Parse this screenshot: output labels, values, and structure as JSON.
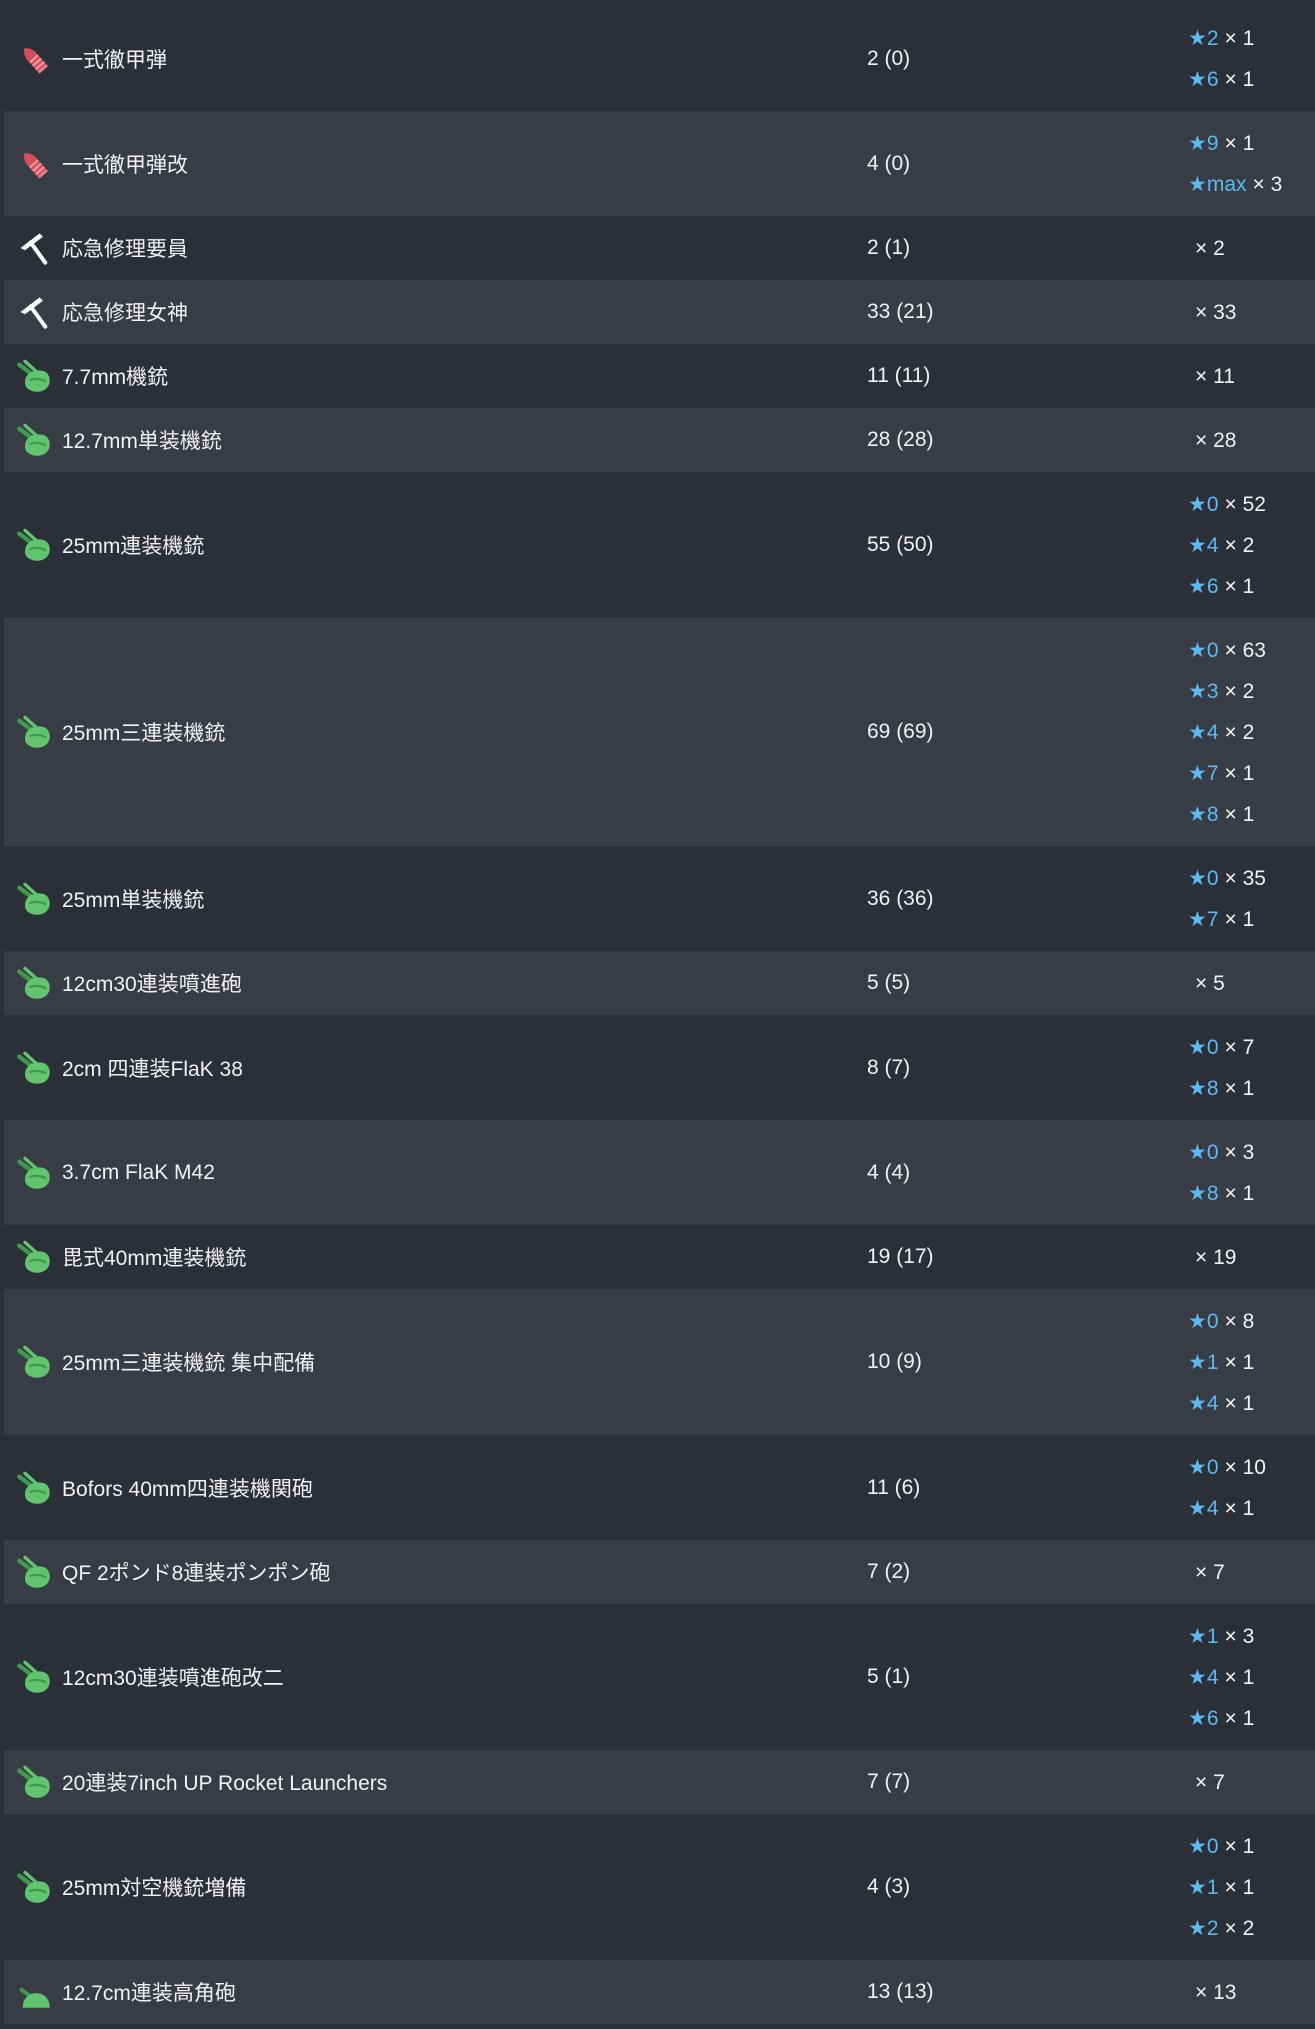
{
  "colors": {
    "background": "#2b2f37",
    "row_alt": "#383c45",
    "text": "#f2f2f2",
    "star": "#5cb9f2",
    "icon_green": "#62c46e",
    "icon_green_dark": "#3f9a4d",
    "icon_red": "#d64f5c",
    "icon_red_light": "#f29aa3",
    "icon_white": "#ffffff"
  },
  "rows": [
    {
      "icon": "armor-piercing-shell-icon",
      "name": "一式徹甲弾",
      "count": "2 (0)",
      "levels": [
        {
          "star": "★2",
          "qty": "× 1"
        },
        {
          "star": "★6",
          "qty": "× 1"
        }
      ]
    },
    {
      "icon": "armor-piercing-shell-icon",
      "name": "一式徹甲弾改",
      "count": "4 (0)",
      "levels": [
        {
          "star": "★9",
          "qty": "× 1"
        },
        {
          "star": "★max",
          "qty": "× 3"
        }
      ]
    },
    {
      "icon": "repair-tool-icon",
      "name": "応急修理要員",
      "count": "2 (1)",
      "levels": [
        {
          "qty": "× 2"
        }
      ]
    },
    {
      "icon": "repair-tool-icon",
      "name": "応急修理女神",
      "count": "33 (21)",
      "levels": [
        {
          "qty": "× 33"
        }
      ]
    },
    {
      "icon": "aa-gun-icon",
      "name": "7.7mm機銃",
      "count": "11 (11)",
      "levels": [
        {
          "qty": "× 11"
        }
      ]
    },
    {
      "icon": "aa-gun-icon",
      "name": "12.7mm単装機銃",
      "count": "28 (28)",
      "levels": [
        {
          "qty": "× 28"
        }
      ]
    },
    {
      "icon": "aa-gun-icon",
      "name": "25mm連装機銃",
      "count": "55 (50)",
      "levels": [
        {
          "star": "★0",
          "qty": "× 52"
        },
        {
          "star": "★4",
          "qty": "× 2"
        },
        {
          "star": "★6",
          "qty": "× 1"
        }
      ]
    },
    {
      "icon": "aa-gun-icon",
      "name": "25mm三連装機銃",
      "count": "69 (69)",
      "levels": [
        {
          "star": "★0",
          "qty": "× 63"
        },
        {
          "star": "★3",
          "qty": "× 2"
        },
        {
          "star": "★4",
          "qty": "× 2"
        },
        {
          "star": "★7",
          "qty": "× 1"
        },
        {
          "star": "★8",
          "qty": "× 1"
        }
      ]
    },
    {
      "icon": "aa-gun-icon",
      "name": "25mm単装機銃",
      "count": "36 (36)",
      "levels": [
        {
          "star": "★0",
          "qty": "× 35"
        },
        {
          "star": "★7",
          "qty": "× 1"
        }
      ]
    },
    {
      "icon": "aa-gun-icon",
      "name": "12cm30連装噴進砲",
      "count": "5 (5)",
      "levels": [
        {
          "qty": "× 5"
        }
      ]
    },
    {
      "icon": "aa-gun-icon",
      "name": "2cm 四連装FlaK 38",
      "count": "8 (7)",
      "levels": [
        {
          "star": "★0",
          "qty": "× 7"
        },
        {
          "star": "★8",
          "qty": "× 1"
        }
      ]
    },
    {
      "icon": "aa-gun-icon",
      "name": "3.7cm FlaK M42",
      "count": "4 (4)",
      "levels": [
        {
          "star": "★0",
          "qty": "× 3"
        },
        {
          "star": "★8",
          "qty": "× 1"
        }
      ]
    },
    {
      "icon": "aa-gun-icon",
      "name": "毘式40mm連装機銃",
      "count": "19 (17)",
      "levels": [
        {
          "qty": "× 19"
        }
      ]
    },
    {
      "icon": "aa-gun-icon",
      "name": "25mm三連装機銃 集中配備",
      "count": "10 (9)",
      "levels": [
        {
          "star": "★0",
          "qty": "× 8"
        },
        {
          "star": "★1",
          "qty": "× 1"
        },
        {
          "star": "★4",
          "qty": "× 1"
        }
      ]
    },
    {
      "icon": "aa-gun-icon",
      "name": "Bofors 40mm四連装機関砲",
      "count": "11 (6)",
      "levels": [
        {
          "star": "★0",
          "qty": "× 10"
        },
        {
          "star": "★4",
          "qty": "× 1"
        }
      ]
    },
    {
      "icon": "aa-gun-icon",
      "name": "QF 2ポンド8連装ポンポン砲",
      "count": "7 (2)",
      "levels": [
        {
          "qty": "× 7"
        }
      ]
    },
    {
      "icon": "aa-gun-icon",
      "name": "12cm30連装噴進砲改二",
      "count": "5 (1)",
      "levels": [
        {
          "star": "★1",
          "qty": "× 3"
        },
        {
          "star": "★4",
          "qty": "× 1"
        },
        {
          "star": "★6",
          "qty": "× 1"
        }
      ]
    },
    {
      "icon": "aa-gun-icon",
      "name": "20連装7inch UP Rocket Launchers",
      "count": "7 (7)",
      "levels": [
        {
          "qty": "× 7"
        }
      ]
    },
    {
      "icon": "aa-gun-icon",
      "name": "25mm対空機銃増備",
      "count": "4 (3)",
      "levels": [
        {
          "star": "★0",
          "qty": "× 1"
        },
        {
          "star": "★1",
          "qty": "× 1"
        },
        {
          "star": "★2",
          "qty": "× 2"
        }
      ]
    },
    {
      "icon": "high-angle-gun-icon",
      "name": "12.7cm連装高角砲",
      "count": "13 (13)",
      "levels": [
        {
          "qty": "× 13"
        }
      ]
    }
  ]
}
